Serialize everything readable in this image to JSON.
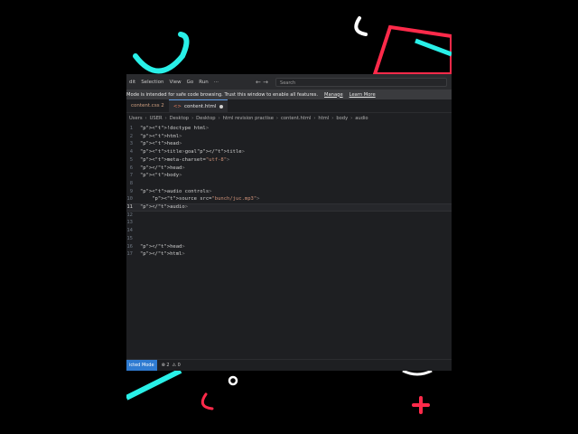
{
  "menu": [
    "dit",
    "Selection",
    "View",
    "Go",
    "Run",
    "···"
  ],
  "nav_arrows": "←   →",
  "search": {
    "placeholder": "Search"
  },
  "banner": {
    "text": "Mode is intended for safe code browsing. Trust this window to enable all features.",
    "manage": "Manage",
    "learn_more": "Learn More"
  },
  "tabs": [
    {
      "label": "content.css 2",
      "active": false
    },
    {
      "label": "content.html",
      "active": true
    }
  ],
  "breadcrumb": [
    "Users",
    "USER",
    "Desktop",
    "Desktop",
    "html revision practise",
    "content.html",
    "html",
    "body",
    "audio"
  ],
  "code_lines": [
    {
      "n": "1",
      "code": "<!doctype html>"
    },
    {
      "n": "2",
      "code": "<html>"
    },
    {
      "n": "3",
      "code": "<head>"
    },
    {
      "n": "4",
      "code": "<title>goal</title>"
    },
    {
      "n": "5",
      "code": "<meta-charset=\"utf-8\">"
    },
    {
      "n": "6",
      "code": "</head>"
    },
    {
      "n": "7",
      "code": "<body>"
    },
    {
      "n": "8",
      "code": ""
    },
    {
      "n": "9",
      "code": "<audio controls>"
    },
    {
      "n": "10",
      "code": "    <source src=\"bunch/juc.mp3\">"
    },
    {
      "n": "11",
      "code": "</audio>"
    },
    {
      "n": "12",
      "code": ""
    },
    {
      "n": "13",
      "code": ""
    },
    {
      "n": "14",
      "code": ""
    },
    {
      "n": "15",
      "code": ""
    },
    {
      "n": "16",
      "code": "</head>"
    },
    {
      "n": "17",
      "code": "</html>"
    }
  ],
  "current_line": "11",
  "status": {
    "mode": "icted Mode",
    "errors": "⊗ 2",
    "warnings": "⚠ 0"
  },
  "colors": {
    "neon_cyan": "#29f0e8",
    "neon_red": "#ff2a4a",
    "editor_bg": "#1e1f22",
    "accent": "#2f7bd1"
  }
}
